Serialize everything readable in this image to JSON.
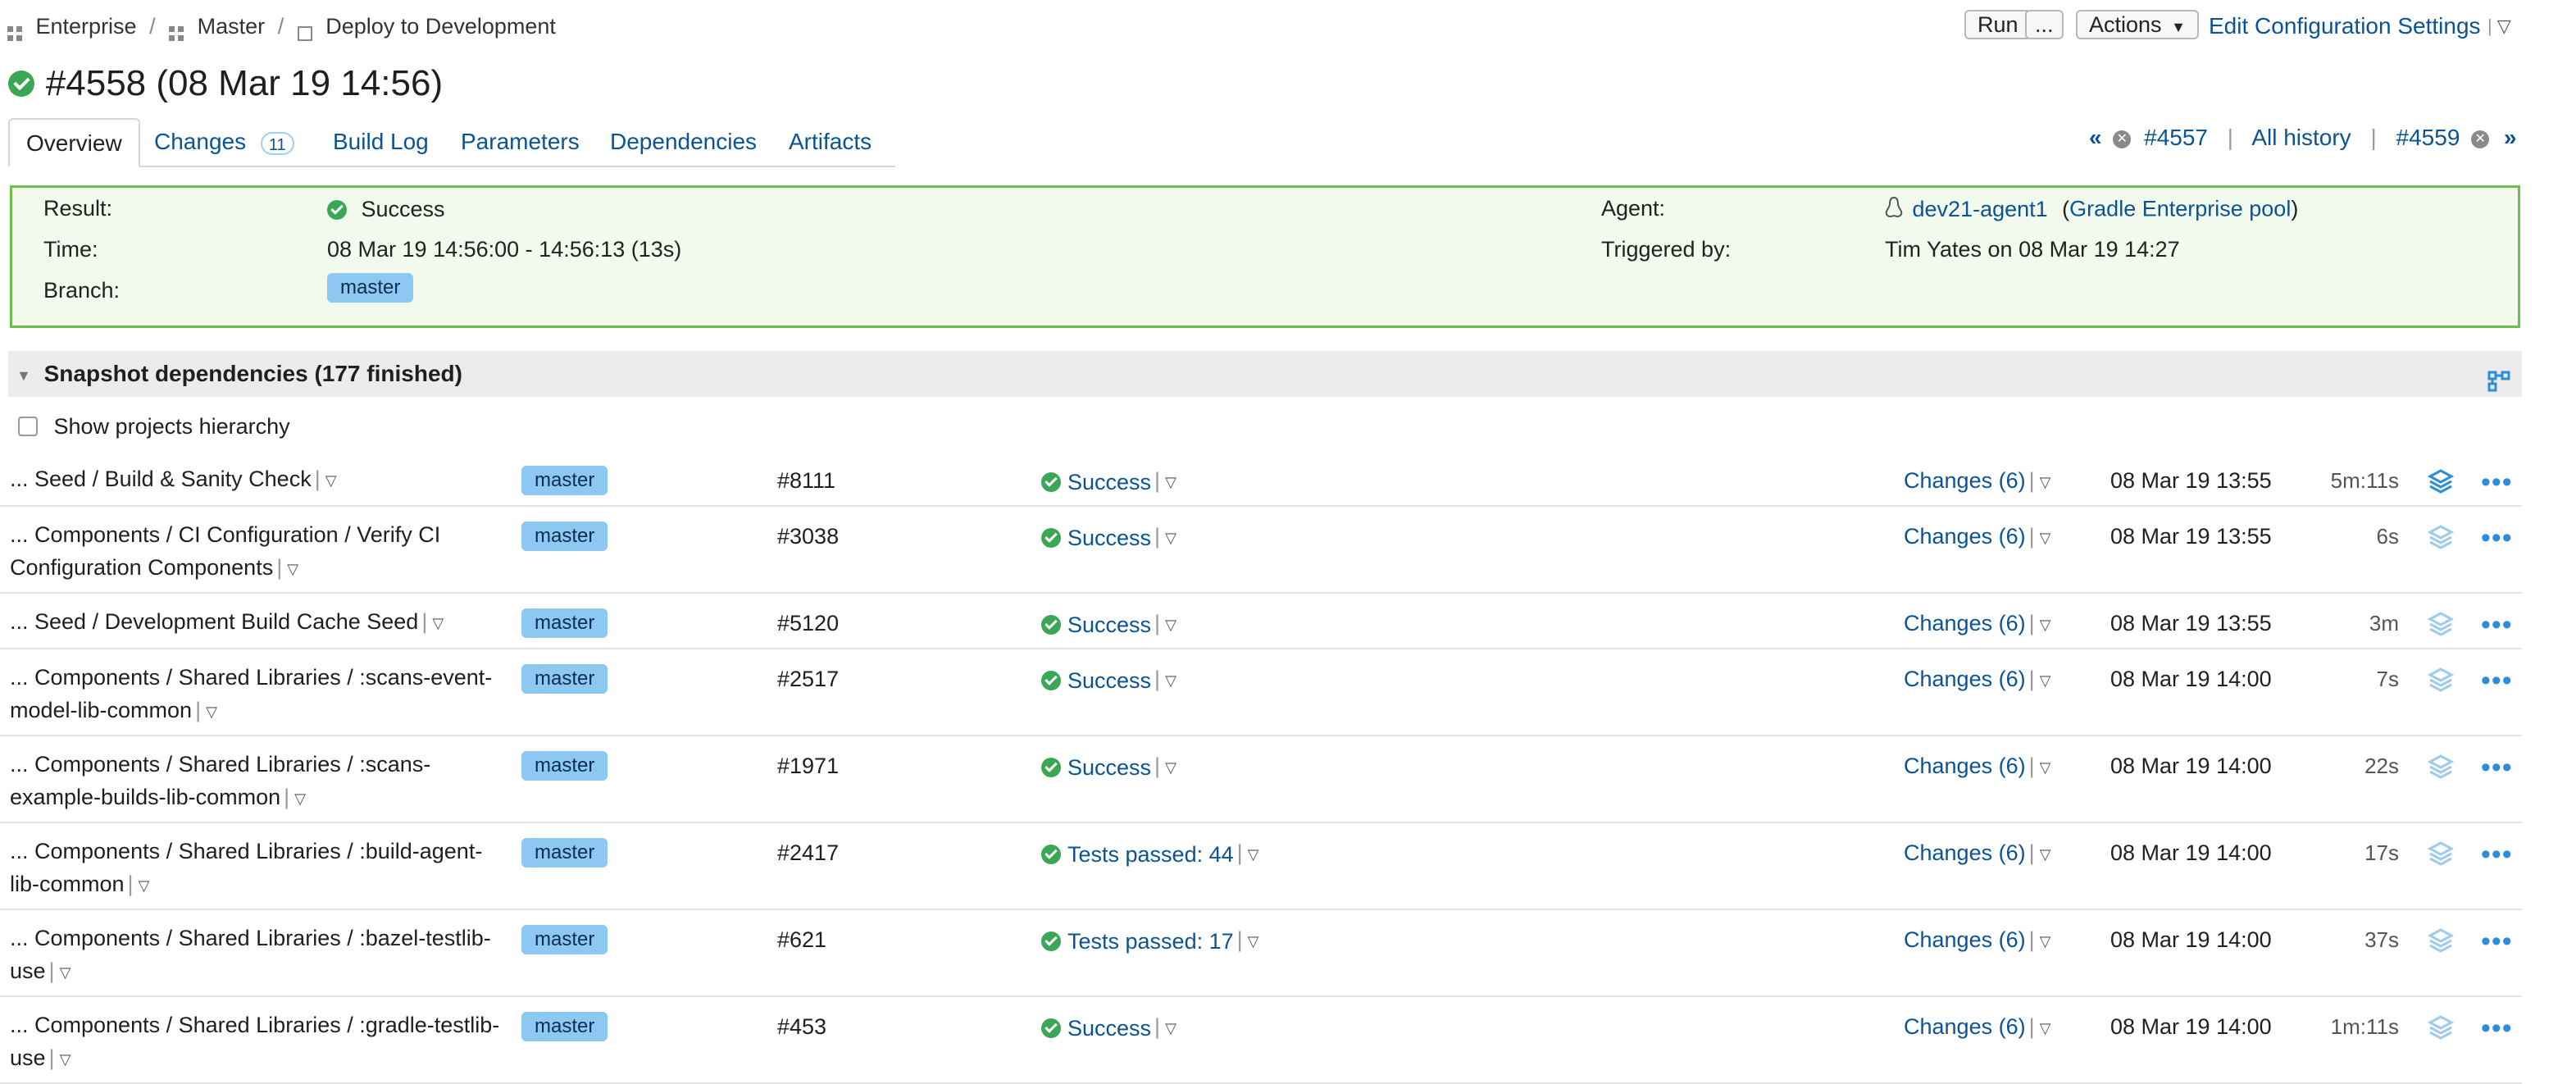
{
  "breadcrumb": {
    "items": [
      "Enterprise",
      "Master",
      "Deploy to Development"
    ],
    "separator": "/"
  },
  "header_actions": {
    "run_label": "Run",
    "run_more_label": "...",
    "actions_label": "Actions",
    "edit_label": "Edit Configuration Settings"
  },
  "build": {
    "title": "#4558 (08 Mar 19 14:56)"
  },
  "tabs": [
    {
      "label": "Overview"
    },
    {
      "label": "Changes",
      "count": "11"
    },
    {
      "label": "Build Log"
    },
    {
      "label": "Parameters"
    },
    {
      "label": "Dependencies"
    },
    {
      "label": "Artifacts"
    }
  ],
  "history_nav": {
    "prev_label": "#4557",
    "all_label": "All history",
    "next_label": "#4559"
  },
  "summary": {
    "result_label": "Result:",
    "result_value": "Success",
    "time_label": "Time:",
    "time_value": "08 Mar 19 14:56:00 - 14:56:13 (13s)",
    "branch_label": "Branch:",
    "branch_value": "master",
    "agent_label": "Agent:",
    "agent_name": "dev21-agent1",
    "agent_pool": "Gradle Enterprise pool",
    "triggered_label": "Triggered by:",
    "triggered_value": "Tim Yates on 08 Mar 19 14:27"
  },
  "dependencies": {
    "header": "Snapshot dependencies (177 finished)",
    "show_hierarchy_label": "Show projects hierarchy",
    "rows": [
      {
        "name": "... Seed / Build & Sanity Check",
        "branch": "master",
        "number": "#8111",
        "status": "Success",
        "changes": "Changes (6)",
        "date": "08 Mar 19 13:55",
        "duration": "5m:11s"
      },
      {
        "name": "... Components / CI Configuration / Verify CI Configuration Components",
        "branch": "master",
        "number": "#3038",
        "status": "Success",
        "changes": "Changes (6)",
        "date": "08 Mar 19 13:55",
        "duration": "6s"
      },
      {
        "name": "... Seed / Development Build Cache Seed",
        "branch": "master",
        "number": "#5120",
        "status": "Success",
        "changes": "Changes (6)",
        "date": "08 Mar 19 13:55",
        "duration": "3m"
      },
      {
        "name": "... Components / Shared Libraries / :scans-event-model-lib-common",
        "branch": "master",
        "number": "#2517",
        "status": "Success",
        "changes": "Changes (6)",
        "date": "08 Mar 19 14:00",
        "duration": "7s"
      },
      {
        "name": "... Components / Shared Libraries / :scans-example-builds-lib-common",
        "branch": "master",
        "number": "#1971",
        "status": "Success",
        "changes": "Changes (6)",
        "date": "08 Mar 19 14:00",
        "duration": "22s"
      },
      {
        "name": "... Components / Shared Libraries / :build-agent-lib-common",
        "branch": "master",
        "number": "#2417",
        "status": "Tests passed: 44",
        "changes": "Changes (6)",
        "date": "08 Mar 19 14:00",
        "duration": "17s"
      },
      {
        "name": "... Components / Shared Libraries / :bazel-testlib-use",
        "branch": "master",
        "number": "#621",
        "status": "Tests passed: 17",
        "changes": "Changes (6)",
        "date": "08 Mar 19 14:00",
        "duration": "37s"
      },
      {
        "name": "... Components / Shared Libraries / :gradle-testlib-use",
        "branch": "master",
        "number": "#453",
        "status": "Success",
        "changes": "Changes (6)",
        "date": "08 Mar 19 14:00",
        "duration": "1m:11s"
      }
    ]
  },
  "colors": {
    "success": "#3aa757",
    "link": "#0b5394",
    "branch_badge": "#8cc8f2",
    "summary_border": "#6dbf4b"
  }
}
